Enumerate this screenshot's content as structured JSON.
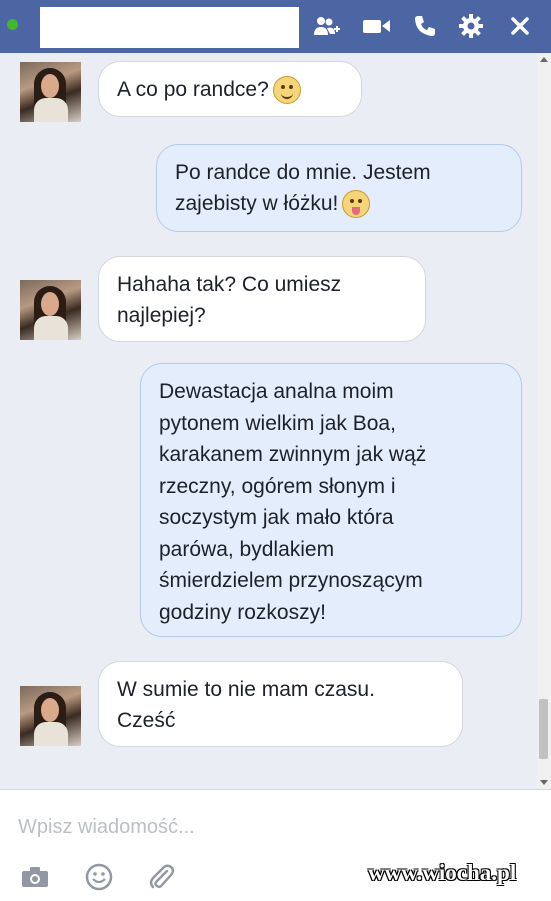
{
  "header": {
    "status": "online",
    "background": "#4c66a4",
    "icons": [
      "add-friend-icon",
      "video-call-icon",
      "phone-icon",
      "settings-icon",
      "close-icon"
    ]
  },
  "messages": [
    {
      "from": "them",
      "text": "A co po randce?",
      "emoji": "smiling-face"
    },
    {
      "from": "me",
      "lines": [
        "Po randce do mnie. Jestem",
        "zajebisty w łóżku!"
      ],
      "emoji": "tongue-face"
    },
    {
      "from": "them",
      "lines": [
        "Hahaha tak? Co umiesz",
        "najlepiej?"
      ]
    },
    {
      "from": "me",
      "lines": [
        "Dewastacja analna moim",
        "pytonem wielkim jak Boa,",
        "karakanem zwinnym jak wąż",
        "rzeczny, ogórem słonym i",
        "soczystym jak mało która",
        "parówa, bydlakiem",
        "śmierdzielem przynoszącym",
        "godziny rozkoszy!"
      ]
    },
    {
      "from": "them",
      "lines": [
        "W sumie to nie mam czasu.",
        "Cześć"
      ]
    }
  ],
  "composer": {
    "placeholder": "Wpisz wiadomość...",
    "icons": [
      "camera-icon",
      "emoji-icon",
      "attachment-icon"
    ]
  },
  "watermark": {
    "text": "www.wiocha.pl"
  }
}
